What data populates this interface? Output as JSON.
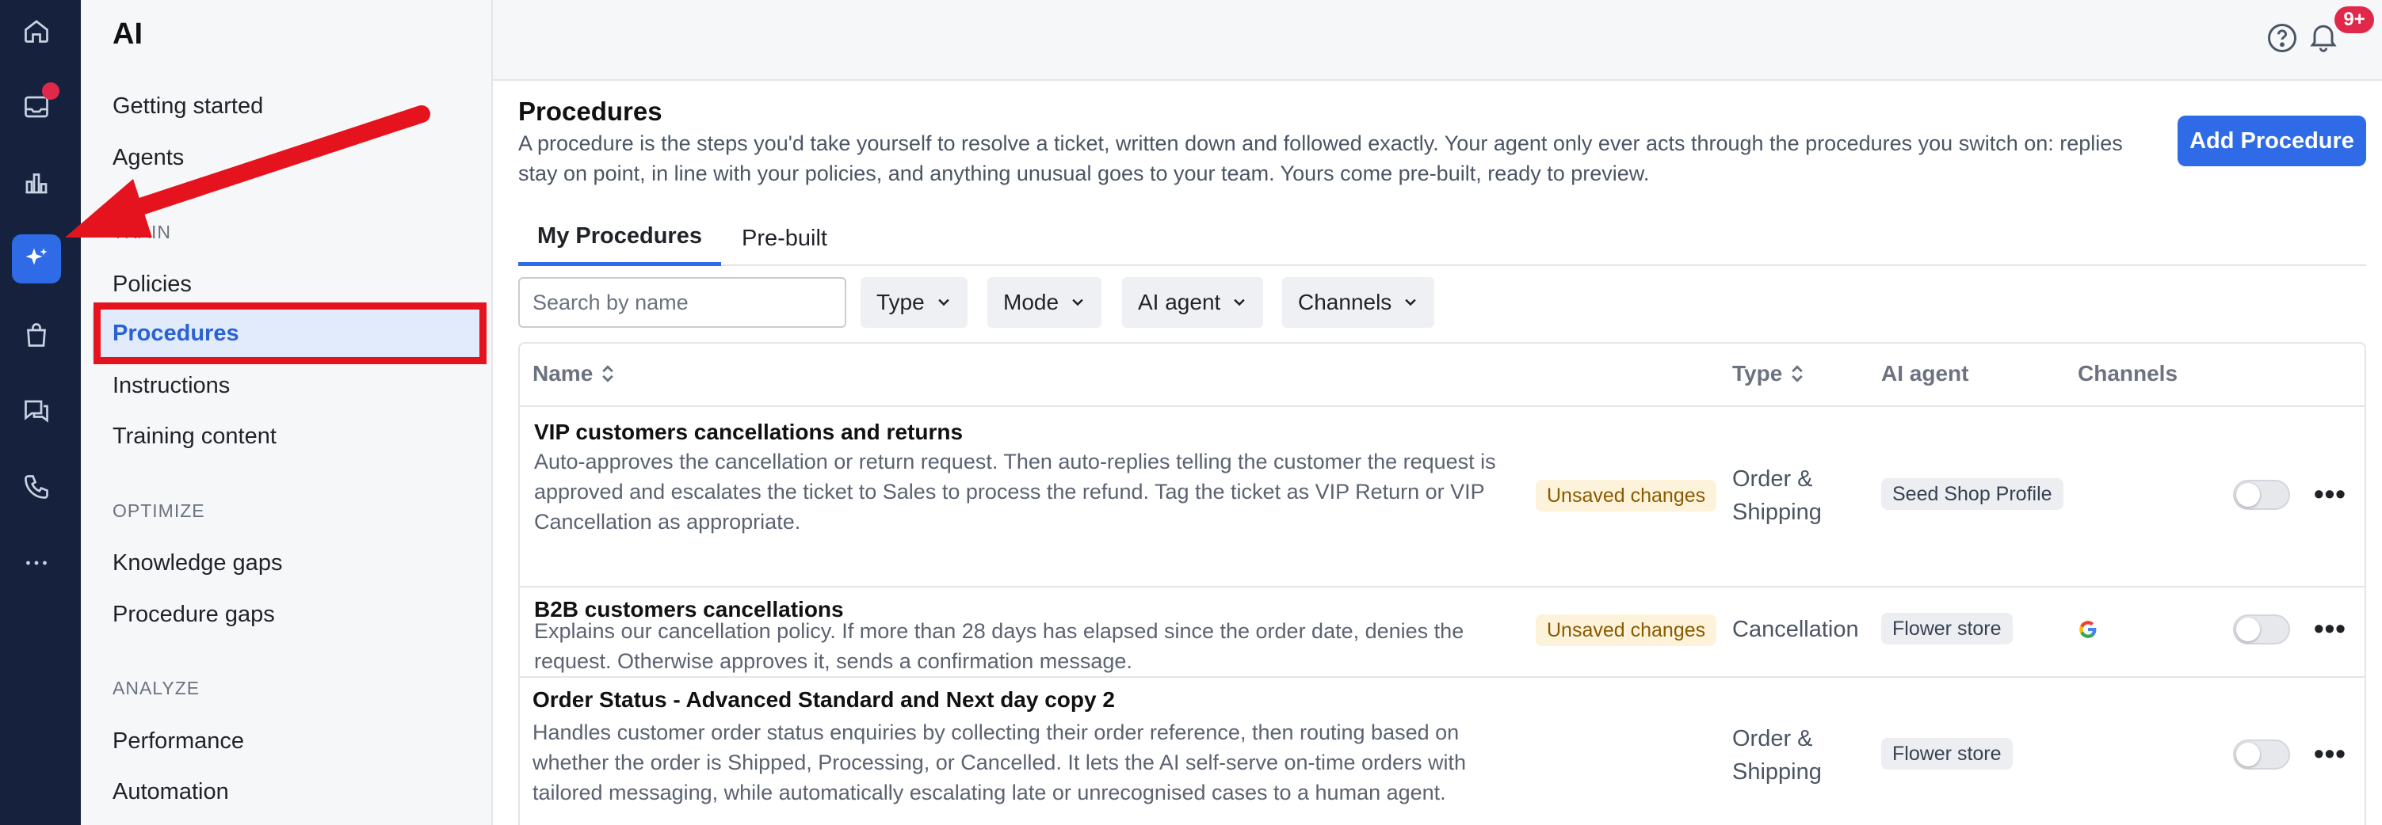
{
  "sidebar": {
    "title": "AI",
    "items": {
      "getting_started": "Getting started",
      "agents": "Agents",
      "policies": "Policies",
      "procedures": "Procedures",
      "instructions": "Instructions",
      "training_content": "Training content",
      "knowledge_gaps": "Knowledge gaps",
      "procedure_gaps": "Procedure gaps",
      "performance": "Performance",
      "automation": "Automation"
    },
    "sections": {
      "train": "TRAIN",
      "optimize": "OPTIMIZE",
      "analyze": "ANALYZE"
    }
  },
  "header": {
    "notification_badge": "9+"
  },
  "main": {
    "title": "Procedures",
    "description": "A procedure is the steps you'd take yourself to resolve a ticket, written down and followed exactly. Your agent only ever acts through the procedures you switch on: replies stay on point, in line with your policies, and anything unusual goes to your team. Yours come pre-built, ready to preview.",
    "add_button": "Add Procedure",
    "tabs": [
      "My Procedures",
      "Pre-built"
    ],
    "search_placeholder": "Search by name",
    "filters": [
      "Type",
      "Mode",
      "AI agent",
      "Channels"
    ],
    "columns": {
      "name": "Name",
      "type": "Type",
      "ai_agent": "AI agent",
      "channels": "Channels"
    },
    "rows": [
      {
        "title": "VIP customers cancellations and returns",
        "description": "Auto-approves the cancellation or return request. Then auto-replies telling the customer the request is approved and escalates the ticket to Sales to process the refund. Tag the ticket as VIP Return or VIP Cancellation as appropriate.",
        "status": "Unsaved changes",
        "type": "Order & Shipping",
        "agent": "Seed Shop Profile",
        "channel_icon": ""
      },
      {
        "title": "B2B customers cancellations",
        "description": "Explains our cancellation policy. If more than 28 days has elapsed since the order date, denies the request. Otherwise approves it, sends a confirmation message.",
        "status": "Unsaved changes",
        "type": "Cancellation",
        "agent": "Flower store",
        "channel_icon": "google-icon"
      },
      {
        "title": "Order Status - Advanced Standard and Next day copy 2",
        "description": "Handles customer order status enquiries by collecting their order reference, then routing based on whether the order is Shipped, Processing, or Cancelled. It lets the AI self-serve on-time orders with tailored messaging, while automatically escalating late or unrecognised cases to a human agent.",
        "status": "",
        "type": "Order & Shipping",
        "agent": "Flower store",
        "channel_icon": ""
      }
    ]
  },
  "colors": {
    "rail": "#16223d",
    "accent": "#2f6be6",
    "annotation_red": "#e5131d",
    "warn_bg": "#fdf3da"
  }
}
